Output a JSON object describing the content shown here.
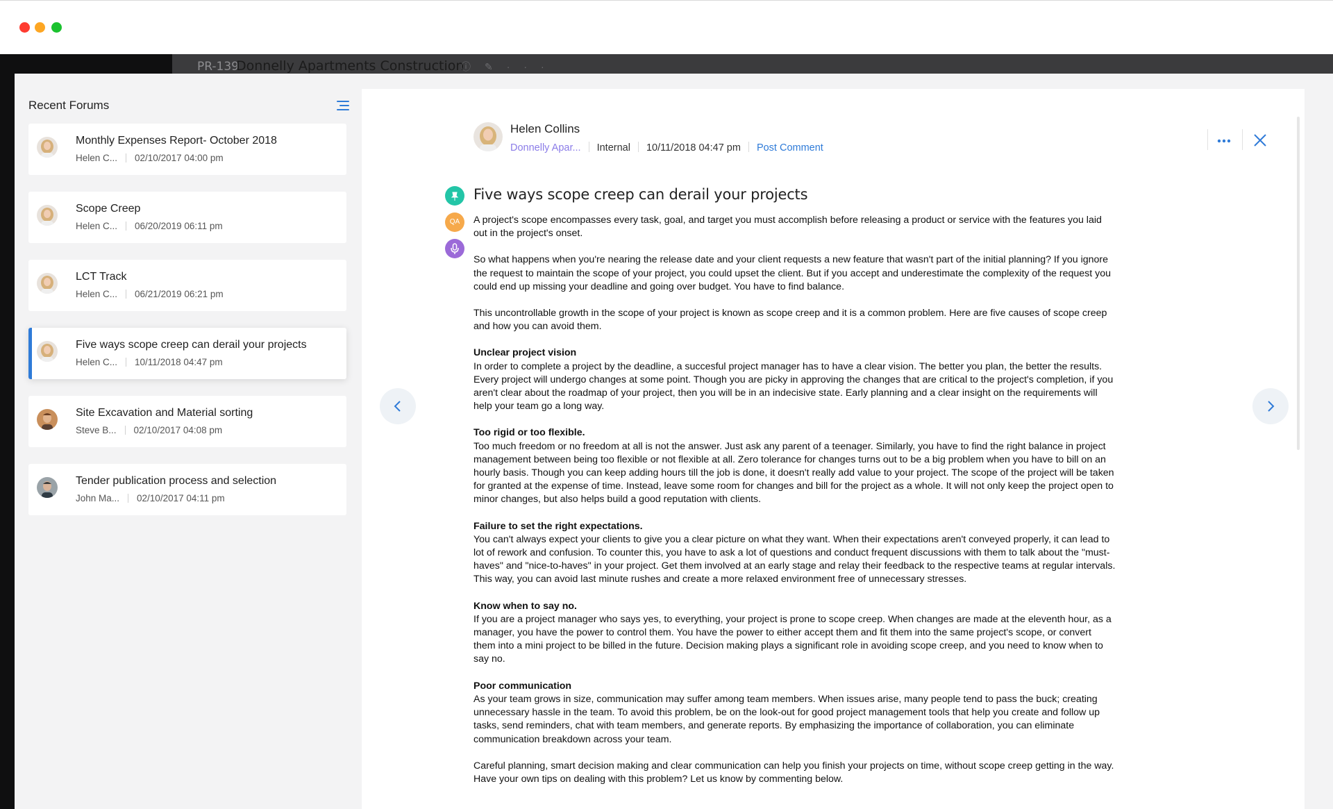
{
  "app_header": {
    "project_id": "PR-139",
    "project_title": "Donnelly Apartments Construction"
  },
  "sidebar": {
    "title": "Recent Forums",
    "items": [
      {
        "title": "Monthly Expenses Report- October 2018",
        "author": "Helen C...",
        "date": "02/10/2017 04:00 pm",
        "active": false,
        "avatar": "helen"
      },
      {
        "title": "Scope Creep",
        "author": "Helen C...",
        "date": "06/20/2019 06:11 pm",
        "active": false,
        "avatar": "helen"
      },
      {
        "title": "LCT Track",
        "author": "Helen C...",
        "date": "06/21/2019 06:21 pm",
        "active": false,
        "avatar": "helen"
      },
      {
        "title": "Five ways scope creep can derail your projects",
        "author": "Helen C...",
        "date": "10/11/2018 04:47 pm",
        "active": true,
        "avatar": "helen"
      },
      {
        "title": "Site Excavation and Material sorting",
        "author": "Steve B...",
        "date": "02/10/2017 04:08 pm",
        "active": false,
        "avatar": "steve"
      },
      {
        "title": "Tender publication process and selection",
        "author": "John Ma...",
        "date": "02/10/2017 04:11 pm",
        "active": false,
        "avatar": "john"
      }
    ]
  },
  "post": {
    "author": "Helen Collins",
    "project_link": "Donnelly Apar...",
    "visibility": "Internal",
    "date": "10/11/2018 04:47 pm",
    "action": "Post Comment",
    "title": "Five ways scope creep can derail your projects",
    "badge_qa": "QA",
    "paragraphs": [
      {
        "heading": "",
        "text": "A project's scope encompasses every task, goal, and target you must accomplish before releasing a product or service with the features you laid out in the project's onset."
      },
      {
        "heading": "",
        "text": "So what happens when you're nearing the release date and your client requests a new feature that wasn't part of the initial planning? If you ignore the request to maintain the scope of your project, you could upset the client. But if you accept and underestimate the complexity of the request you could end up missing your deadline and going over budget. You have to find balance."
      },
      {
        "heading": "",
        "text": "This uncontrollable growth in the scope of your project is known as scope creep and it is a common problem. Here are five causes of scope creep and how you can avoid them."
      },
      {
        "heading": "Unclear project vision",
        "text": "In order to complete a project by the deadline, a succesful project manager has to have a clear vision. The better you plan, the better the results. Every project will undergo changes at some point. Though you are picky in approving the changes that are critical to the project's completion, if you aren't clear about the roadmap of your project, then you will be in an indecisive state. Early planning and a clear insight on the requirements will help your team go a long way."
      },
      {
        "heading": "Too rigid or too flexible.",
        "text": "Too much freedom or no freedom at all is not the answer. Just ask any parent of a teenager. Similarly, you have to find the right balance in project management between being too flexible or not flexible at all. Zero tolerance for changes turns out to be a big problem when you have to bill on an hourly basis. Though you can keep adding hours till the job is done, it doesn't really add value to your project. The scope of the project will be taken for granted at the expense of time. Instead, leave some room for changes and bill for the project as a whole. It will not only keep the project open to minor changes, but also helps build a good reputation with clients."
      },
      {
        "heading": "Failure to set the right expectations.",
        "text": "You can't always expect your clients to give you a clear picture on what they want. When their expectations aren't conveyed properly, it can lead to lot of rework and confusion. To counter this, you have to ask a lot of questions and conduct frequent discussions with them to talk about the \"must-haves\" and \"nice-to-haves\" in your project. Get them involved at an early stage and relay their feedback to the respective teams at regular intervals. This way, you can avoid last minute rushes and create a more relaxed environment free of unnecessary stresses."
      },
      {
        "heading": "Know when to say no.",
        "text": "If you are a project manager who says yes, to everything, your project is prone to scope creep. When changes are made at the eleventh hour, as a manager, you have the power to control them. You have the power to either accept them and fit them into the same project's scope, or convert them into a mini project to be billed in the future. Decision making plays a significant role in avoiding scope creep, and you need to know when to say no."
      },
      {
        "heading": "Poor communication",
        "text": "As your team grows in size, communication may suffer among team members. When issues arise, many people tend to pass the buck; creating unnecessary hassle in the team. To avoid this problem, be on the look-out for good project management tools that help you create and follow up tasks, send reminders, chat with team members, and generate reports. By emphasizing the importance of collaboration, you can eliminate communication breakdown across your team."
      },
      {
        "heading": "",
        "text": "Careful planning, smart decision making and clear communication can help you finish your projects on time, without scope creep getting in the way. Have your own tips on dealing with this problem? Let us know by commenting below."
      }
    ]
  },
  "colors": {
    "accent": "#2f7bd8",
    "link_purple": "#8b7ce8",
    "pin_badge": "#23c5a7",
    "qa_badge": "#f6a94b",
    "mic_badge": "#9b6ad8"
  },
  "icons": [
    "menu-icon",
    "more-icon",
    "close-icon",
    "chevron-left-icon",
    "chevron-right-icon",
    "pin-icon",
    "microphone-icon",
    "info-icon",
    "edit-icon"
  ]
}
